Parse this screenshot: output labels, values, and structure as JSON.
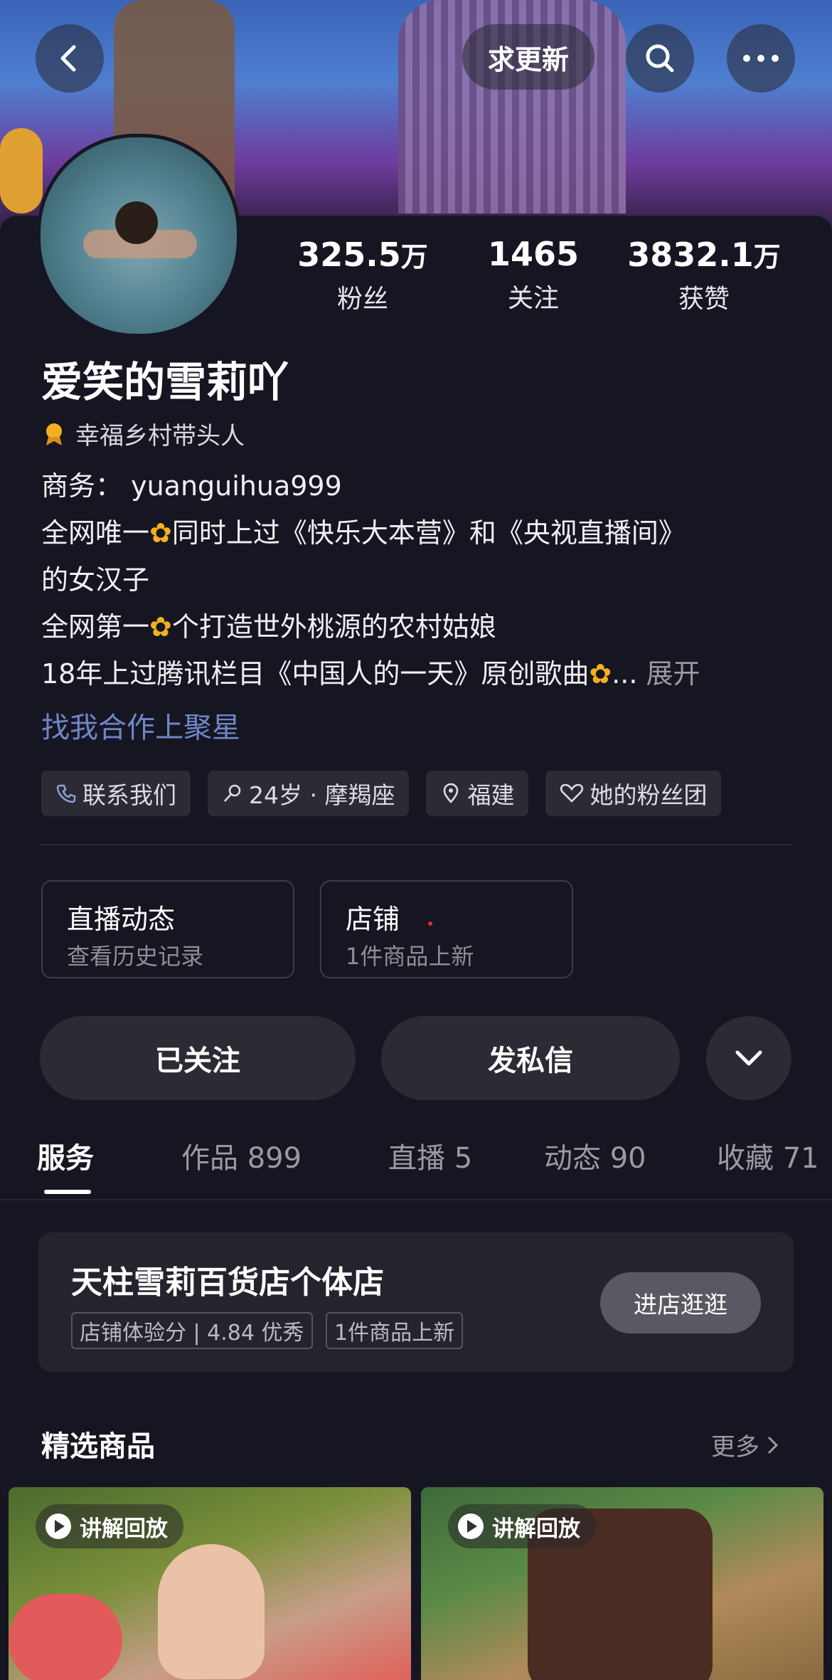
{
  "header": {
    "title": "求更新"
  },
  "stats": [
    {
      "value": "325.5",
      "unit": "万",
      "label": "粉丝"
    },
    {
      "value": "1465",
      "unit": "",
      "label": "关注"
    },
    {
      "value": "3832.1",
      "unit": "万",
      "label": "获赞"
    }
  ],
  "profile": {
    "name": "爱笑的雪莉吖",
    "honor": "幸福乡村带头人",
    "bio": {
      "line1": "商务： yuanguihua999",
      "line2a": "全网唯一",
      "line2b": "同时上过《快乐大本营》和《央视直播间》",
      "line3": "的女汉子",
      "line4a": "全网第一",
      "line4b": "个打造世外桃源的农村姑娘",
      "line5a": "18年上过腾讯栏目《中国人的一天》原创歌曲",
      "line5b": "...",
      "expand": "展开"
    },
    "star_link": "找我合作上聚星",
    "tags": [
      "联系我们",
      "24岁 · 摩羯座",
      "福建",
      "她的粉丝团"
    ]
  },
  "cards": [
    {
      "title": "直播动态",
      "sub": "查看历史记录"
    },
    {
      "title": "店铺",
      "sub": "1件商品上新"
    }
  ],
  "actions": {
    "follow": "已关注",
    "message": "发私信"
  },
  "tabs": [
    "服务",
    "作品 899",
    "直播 5",
    "动态 90",
    "收藏 71"
  ],
  "store": {
    "name": "天柱雪莉百货店个体店",
    "score": "店铺体验分 | 4.84 优秀",
    "new": "1件商品上新",
    "enter": "进店逛逛"
  },
  "section": {
    "title": "精选商品",
    "more": "更多"
  },
  "products": [
    {
      "badge": "讲解回放"
    },
    {
      "badge": "讲解回放"
    }
  ],
  "colors": {
    "background": "#161622",
    "link": "#6f86c7",
    "sunflower": "#f2b01e"
  }
}
